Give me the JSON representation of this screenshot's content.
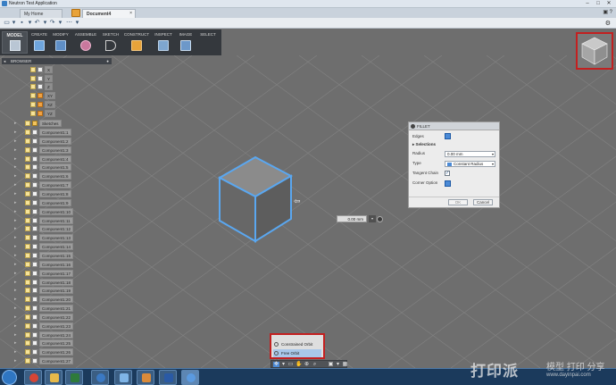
{
  "window": {
    "title": "Neutron Test Application"
  },
  "tabs": [
    {
      "label": "My Home"
    },
    {
      "label": "Document4",
      "close": "×"
    }
  ],
  "ribbon": {
    "workspace": "MODEL",
    "groups": [
      "CREATE",
      "MODIFY",
      "ASSEMBLE",
      "SKETCH",
      "CONSTRUCT",
      "INSPECT",
      "IMAGE",
      "SELECT"
    ]
  },
  "browser": {
    "title": "BROWSER",
    "origin_items": [
      "X",
      "Y",
      "Z",
      "XY",
      "XZ",
      "YZ"
    ],
    "sketches_label": "Sketches",
    "components": [
      "Component1:1",
      "Component1:2",
      "Component1:3",
      "Component1:4",
      "Component1:5",
      "Component1:6",
      "Component1:7",
      "Component1:8",
      "Component1:9",
      "Component1:10",
      "Component1:11",
      "Component1:12",
      "Component1:13",
      "Component1:14",
      "Component1:15",
      "Component1:16",
      "Component1:17",
      "Component1:18",
      "Component1:19",
      "Component1:20",
      "Component1:21",
      "Component1:22",
      "Component1:23",
      "Component1:24",
      "Component1:25",
      "Component1:26",
      "Component1:27"
    ]
  },
  "fillet": {
    "title": "FILLET",
    "edges_label": "Edges",
    "selections_label": "Selections",
    "radius_label": "Radius",
    "radius_value": "0.00 mm",
    "type_label": "Type",
    "type_value": "Constant Radius",
    "tangent_label": "Tangent Chain",
    "corner_label": "Corner Option",
    "ok_label": "OK",
    "cancel_label": "Cancel"
  },
  "inline_radius": "0.00 mm",
  "orbit_menu": {
    "options": [
      "Constrained Orbit",
      "Free Orbit"
    ],
    "selected": "Free Orbit"
  },
  "watermark": {
    "big": "打印派",
    "small": "模型 打印 分享",
    "url": "www.dayinpai.com"
  },
  "colors": {
    "accent": "#4b8ad6",
    "highlight_red": "#c32020",
    "viewport": "#6e6e6e"
  }
}
